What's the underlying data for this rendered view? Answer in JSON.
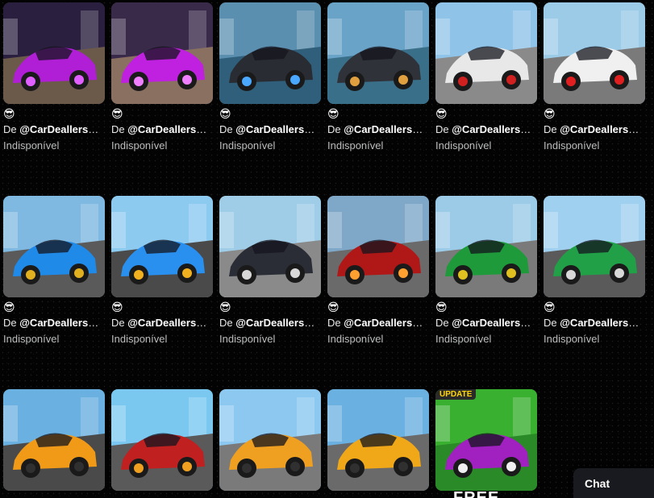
{
  "cards": [
    {
      "emoji": "😎",
      "by": "De",
      "creator": "@CarDeallersOfficial",
      "status": "Indisponível",
      "sky": "#2a1f3f",
      "ground": "#6b5a4a",
      "car": "#b01ed6",
      "accent": "#e060ff"
    },
    {
      "emoji": "😎",
      "by": "De",
      "creator": "@CarDeallersOfficial",
      "status": "Indisponível",
      "sky": "#3a2a4a",
      "ground": "#8a7060",
      "car": "#c020e0",
      "accent": "#f080ff"
    },
    {
      "emoji": "😎",
      "by": "De",
      "creator": "@CarDeallersOfficial",
      "status": "Indisponível",
      "sky": "#5a8fb0",
      "ground": "#2f5f7a",
      "car": "#2a2c33",
      "accent": "#4aa8ff"
    },
    {
      "emoji": "😎",
      "by": "De",
      "creator": "@CarDeallersOfficial",
      "status": "Indisponível",
      "sky": "#6aa3c8",
      "ground": "#3a6f8a",
      "car": "#30323a",
      "accent": "#e0a040"
    },
    {
      "emoji": "😎",
      "by": "De",
      "creator": "@CarDeallersOfficial",
      "status": "Indisponível",
      "sky": "#8fc4e8",
      "ground": "#8a8a8a",
      "car": "#e8e8e8",
      "accent": "#d02020"
    },
    {
      "emoji": "😎",
      "by": "De",
      "creator": "@CarDeallersOfficial",
      "status": "Indisponível",
      "sky": "#9ccbe8",
      "ground": "#7a7a7a",
      "car": "#f0f0f0",
      "accent": "#e02020"
    },
    {
      "emoji": "😎",
      "by": "De",
      "creator": "@CarDeallersOfficial",
      "status": "Indisponível",
      "sky": "#7fb8e0",
      "ground": "#5a5a5a",
      "car": "#1f8ae8",
      "accent": "#e0b020"
    },
    {
      "emoji": "😎",
      "by": "De",
      "creator": "@CarDeallersOfficial",
      "status": "Indisponível",
      "sky": "#8ccaf0",
      "ground": "#4a4a4a",
      "car": "#2a90f0",
      "accent": "#f0b020"
    },
    {
      "emoji": "😎",
      "by": "De",
      "creator": "@CarDeallersOfficial",
      "status": "Indisponível",
      "sky": "#9fcde8",
      "ground": "#8a8a8a",
      "car": "#2a2d35",
      "accent": "#d8d8d8"
    },
    {
      "emoji": "😎",
      "by": "De",
      "creator": "@CarDeallersOfficial",
      "status": "Indisponível",
      "sky": "#7fa8c8",
      "ground": "#6a6a6a",
      "car": "#b01818",
      "accent": "#ffa030"
    },
    {
      "emoji": "😎",
      "by": "De",
      "creator": "@CarDeallersOfficial",
      "status": "Indisponível",
      "sky": "#9ccbe8",
      "ground": "#7a7a7a",
      "car": "#1f9a3a",
      "accent": "#e0c020"
    },
    {
      "emoji": "😎",
      "by": "De",
      "creator": "@CarDeallersOfficial",
      "status": "Indisponível",
      "sky": "#a0d0f0",
      "ground": "#5a5a5a",
      "car": "#22a048",
      "accent": "#d8d8d8"
    },
    {
      "emoji": "",
      "by": "",
      "creator": "",
      "status": "",
      "sky": "#6ab0e0",
      "ground": "#4a4a4a",
      "car": "#f09a18",
      "accent": "#303030"
    },
    {
      "emoji": "",
      "by": "",
      "creator": "",
      "status": "",
      "sky": "#7ac8f0",
      "ground": "#5a5a5a",
      "car": "#c02020",
      "accent": "#f0a020"
    },
    {
      "emoji": "",
      "by": "",
      "creator": "",
      "status": "",
      "sky": "#8cc8f0",
      "ground": "#7a7a7a",
      "car": "#f0a020",
      "accent": "#303030"
    },
    {
      "emoji": "",
      "by": "",
      "creator": "",
      "status": "",
      "sky": "#6ab0e0",
      "ground": "#6a6a6a",
      "car": "#f0a818",
      "accent": "#303030"
    },
    {
      "emoji": "",
      "by": "",
      "creator": "",
      "status": "",
      "sky": "#3ab030",
      "ground": "#2a8a28",
      "car": "#a020c0",
      "accent": "#f0f0f0",
      "tag": "UPDATE",
      "free": "FREE"
    }
  ],
  "chat": {
    "label": "Chat"
  }
}
